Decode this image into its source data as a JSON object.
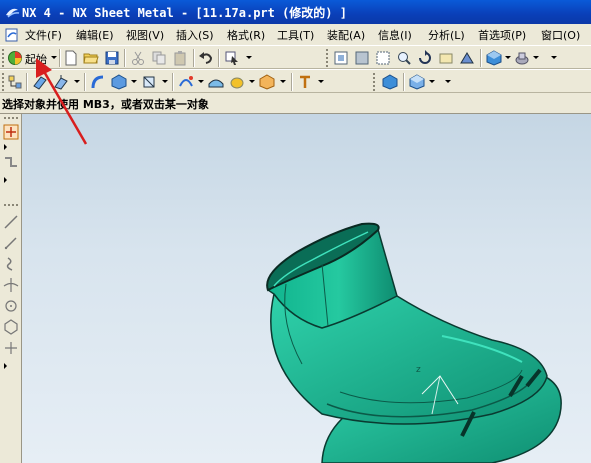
{
  "window": {
    "title": "NX 4 - NX Sheet Metal - [11.17a.prt  (修改的) ]"
  },
  "menu": {
    "items": [
      {
        "label": "文件(F)"
      },
      {
        "label": "编辑(E)"
      },
      {
        "label": "视图(V)"
      },
      {
        "label": "插入(S)"
      },
      {
        "label": "格式(R)"
      },
      {
        "label": "工具(T)"
      },
      {
        "label": "装配(A)"
      },
      {
        "label": "信息(I)"
      },
      {
        "label": "分析(L)"
      },
      {
        "label": "首选项(P)"
      },
      {
        "label": "窗口(O)"
      }
    ]
  },
  "toolbar": {
    "start_label": "起始"
  },
  "cue_line": {
    "text": "选择对象并使用 MB3，或者双击某一对象"
  },
  "colors": {
    "titlebar": "#0a3fb8",
    "model": "#1fa889",
    "arrow": "#d81e1e"
  }
}
